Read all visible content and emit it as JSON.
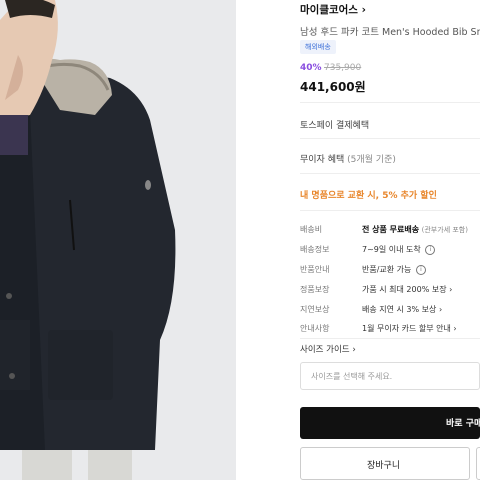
{
  "product": {
    "brand": "마이클코어스",
    "brand_chevron": "›",
    "title": "남성 후드 파카 코트 Men's Hooded Bib Sn",
    "badge": "해외배송",
    "discount": "40%",
    "original_price": "735,900",
    "price": "441,600원"
  },
  "benefits": {
    "toss": "토스페이 결제혜택",
    "muiza": "무이자 혜택",
    "muiza_sub": "(5개월 기준)",
    "trade": "내 명품으로 교환 시, 5% 추가 할인"
  },
  "info": [
    {
      "label": "배송비",
      "value": "전 상품 무료배송",
      "note": "(관부가세 포함)",
      "suffix": ""
    },
    {
      "label": "배송정보",
      "value": "7~9일 이내 도착",
      "note": "",
      "suffix": "i"
    },
    {
      "label": "반품안내",
      "value": "반품/교환 가능",
      "note": "",
      "suffix": "i"
    },
    {
      "label": "정품보장",
      "value": "가품 시 최대 200% 보장",
      "note": "",
      "suffix": "›"
    },
    {
      "label": "지연보상",
      "value": "배송 지연 시 3% 보상",
      "note": "",
      "suffix": "›"
    },
    {
      "label": "안내사항",
      "value": "1월 무이자 카드 할부 안내",
      "note": "",
      "suffix": "›"
    }
  ],
  "size": {
    "guide_label": "사이즈 가이드",
    "guide_chevron": "›",
    "placeholder": "사이즈를 선택해 주세요."
  },
  "buttons": {
    "buy": "바로 구매",
    "cart": "장바구니"
  },
  "colors": {
    "discount": "#8a4fe0",
    "trade": "#e8862c",
    "buy_bg": "#111111"
  }
}
